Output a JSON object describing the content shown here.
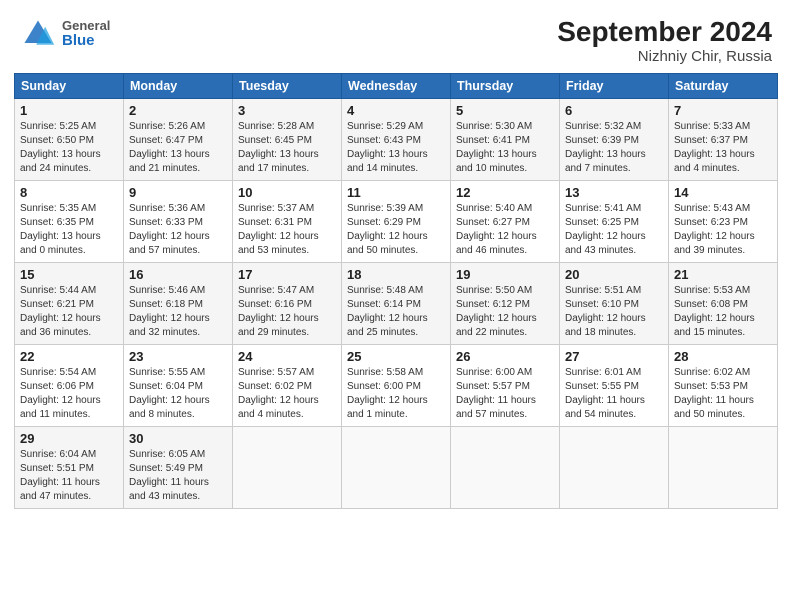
{
  "header": {
    "logo_line1": "General",
    "logo_line2": "Blue",
    "title": "September 2024",
    "subtitle": "Nizhniy Chir, Russia"
  },
  "weekdays": [
    "Sunday",
    "Monday",
    "Tuesday",
    "Wednesday",
    "Thursday",
    "Friday",
    "Saturday"
  ],
  "weeks": [
    [
      {
        "day": "1",
        "sunrise": "5:25 AM",
        "sunset": "6:50 PM",
        "daylight": "13 hours and 24 minutes."
      },
      {
        "day": "2",
        "sunrise": "5:26 AM",
        "sunset": "6:47 PM",
        "daylight": "13 hours and 21 minutes."
      },
      {
        "day": "3",
        "sunrise": "5:28 AM",
        "sunset": "6:45 PM",
        "daylight": "13 hours and 17 minutes."
      },
      {
        "day": "4",
        "sunrise": "5:29 AM",
        "sunset": "6:43 PM",
        "daylight": "13 hours and 14 minutes."
      },
      {
        "day": "5",
        "sunrise": "5:30 AM",
        "sunset": "6:41 PM",
        "daylight": "13 hours and 10 minutes."
      },
      {
        "day": "6",
        "sunrise": "5:32 AM",
        "sunset": "6:39 PM",
        "daylight": "13 hours and 7 minutes."
      },
      {
        "day": "7",
        "sunrise": "5:33 AM",
        "sunset": "6:37 PM",
        "daylight": "13 hours and 4 minutes."
      }
    ],
    [
      {
        "day": "8",
        "sunrise": "5:35 AM",
        "sunset": "6:35 PM",
        "daylight": "13 hours and 0 minutes."
      },
      {
        "day": "9",
        "sunrise": "5:36 AM",
        "sunset": "6:33 PM",
        "daylight": "12 hours and 57 minutes."
      },
      {
        "day": "10",
        "sunrise": "5:37 AM",
        "sunset": "6:31 PM",
        "daylight": "12 hours and 53 minutes."
      },
      {
        "day": "11",
        "sunrise": "5:39 AM",
        "sunset": "6:29 PM",
        "daylight": "12 hours and 50 minutes."
      },
      {
        "day": "12",
        "sunrise": "5:40 AM",
        "sunset": "6:27 PM",
        "daylight": "12 hours and 46 minutes."
      },
      {
        "day": "13",
        "sunrise": "5:41 AM",
        "sunset": "6:25 PM",
        "daylight": "12 hours and 43 minutes."
      },
      {
        "day": "14",
        "sunrise": "5:43 AM",
        "sunset": "6:23 PM",
        "daylight": "12 hours and 39 minutes."
      }
    ],
    [
      {
        "day": "15",
        "sunrise": "5:44 AM",
        "sunset": "6:21 PM",
        "daylight": "12 hours and 36 minutes."
      },
      {
        "day": "16",
        "sunrise": "5:46 AM",
        "sunset": "6:18 PM",
        "daylight": "12 hours and 32 minutes."
      },
      {
        "day": "17",
        "sunrise": "5:47 AM",
        "sunset": "6:16 PM",
        "daylight": "12 hours and 29 minutes."
      },
      {
        "day": "18",
        "sunrise": "5:48 AM",
        "sunset": "6:14 PM",
        "daylight": "12 hours and 25 minutes."
      },
      {
        "day": "19",
        "sunrise": "5:50 AM",
        "sunset": "6:12 PM",
        "daylight": "12 hours and 22 minutes."
      },
      {
        "day": "20",
        "sunrise": "5:51 AM",
        "sunset": "6:10 PM",
        "daylight": "12 hours and 18 minutes."
      },
      {
        "day": "21",
        "sunrise": "5:53 AM",
        "sunset": "6:08 PM",
        "daylight": "12 hours and 15 minutes."
      }
    ],
    [
      {
        "day": "22",
        "sunrise": "5:54 AM",
        "sunset": "6:06 PM",
        "daylight": "12 hours and 11 minutes."
      },
      {
        "day": "23",
        "sunrise": "5:55 AM",
        "sunset": "6:04 PM",
        "daylight": "12 hours and 8 minutes."
      },
      {
        "day": "24",
        "sunrise": "5:57 AM",
        "sunset": "6:02 PM",
        "daylight": "12 hours and 4 minutes."
      },
      {
        "day": "25",
        "sunrise": "5:58 AM",
        "sunset": "6:00 PM",
        "daylight": "12 hours and 1 minute."
      },
      {
        "day": "26",
        "sunrise": "6:00 AM",
        "sunset": "5:57 PM",
        "daylight": "11 hours and 57 minutes."
      },
      {
        "day": "27",
        "sunrise": "6:01 AM",
        "sunset": "5:55 PM",
        "daylight": "11 hours and 54 minutes."
      },
      {
        "day": "28",
        "sunrise": "6:02 AM",
        "sunset": "5:53 PM",
        "daylight": "11 hours and 50 minutes."
      }
    ],
    [
      {
        "day": "29",
        "sunrise": "6:04 AM",
        "sunset": "5:51 PM",
        "daylight": "11 hours and 47 minutes."
      },
      {
        "day": "30",
        "sunrise": "6:05 AM",
        "sunset": "5:49 PM",
        "daylight": "11 hours and 43 minutes."
      },
      null,
      null,
      null,
      null,
      null
    ]
  ]
}
